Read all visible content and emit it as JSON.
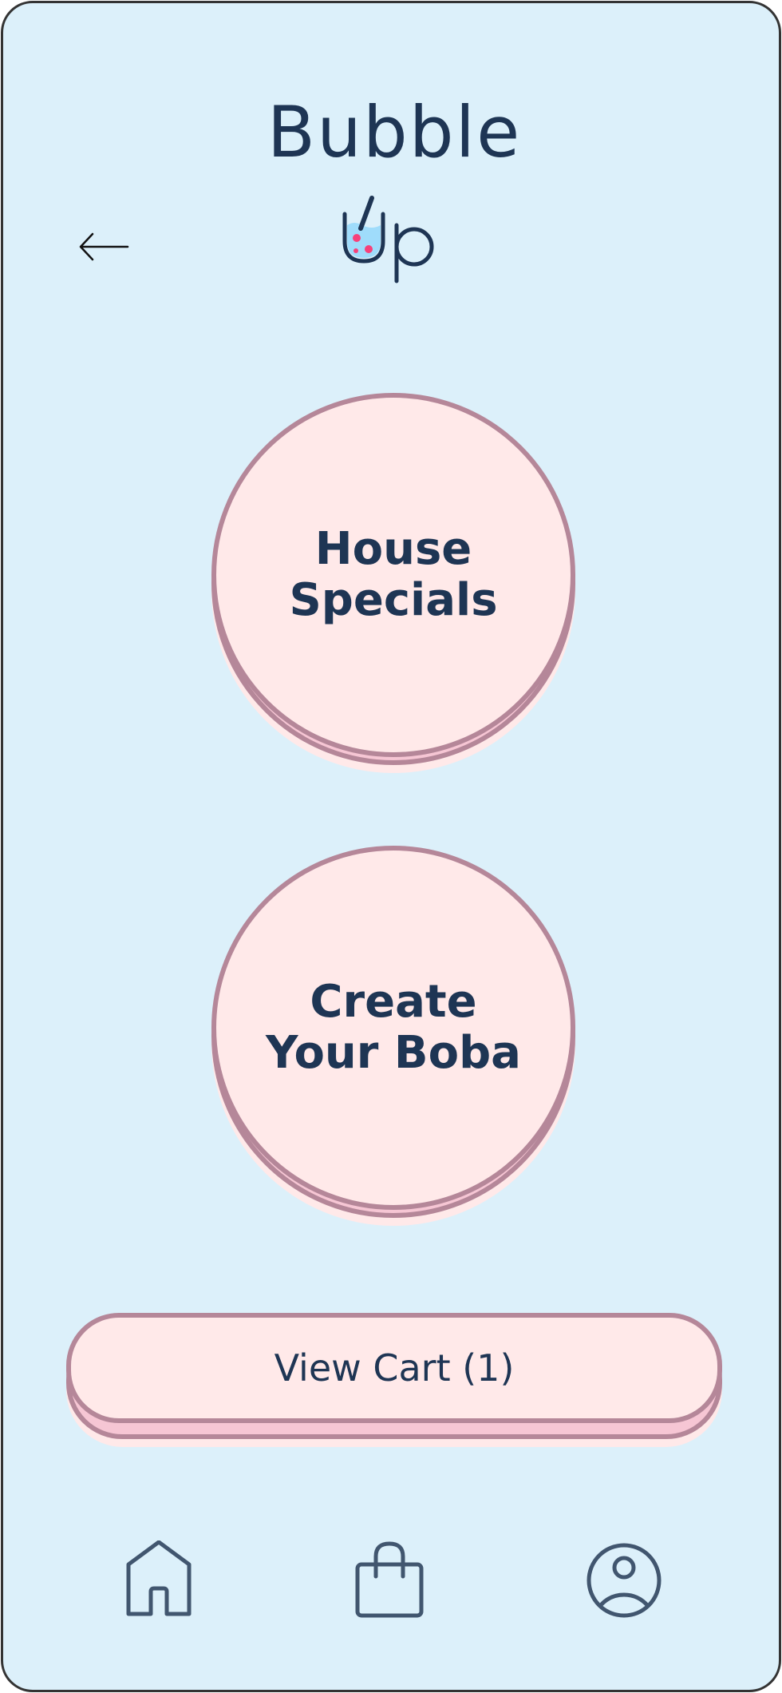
{
  "app": {
    "logo_line1": "Bubble",
    "logo_line2": "Up"
  },
  "header": {
    "back_icon": "arrow-left-icon"
  },
  "main": {
    "options": [
      {
        "label": "House Specials"
      },
      {
        "label": "Create Your Boba"
      }
    ],
    "cart_button": {
      "label": "View Cart (1)"
    }
  },
  "bottom_nav": {
    "items": [
      {
        "icon": "home-icon"
      },
      {
        "icon": "shopping-bag-icon"
      },
      {
        "icon": "user-profile-icon"
      }
    ]
  },
  "colors": {
    "background": "#dcf0fa",
    "button_fill": "#ffe9e9",
    "button_border": "#b58799",
    "text": "#1e3554",
    "icon": "#41566f",
    "boba_pearl": "#f7417a",
    "drink": "#9fdcfb"
  }
}
